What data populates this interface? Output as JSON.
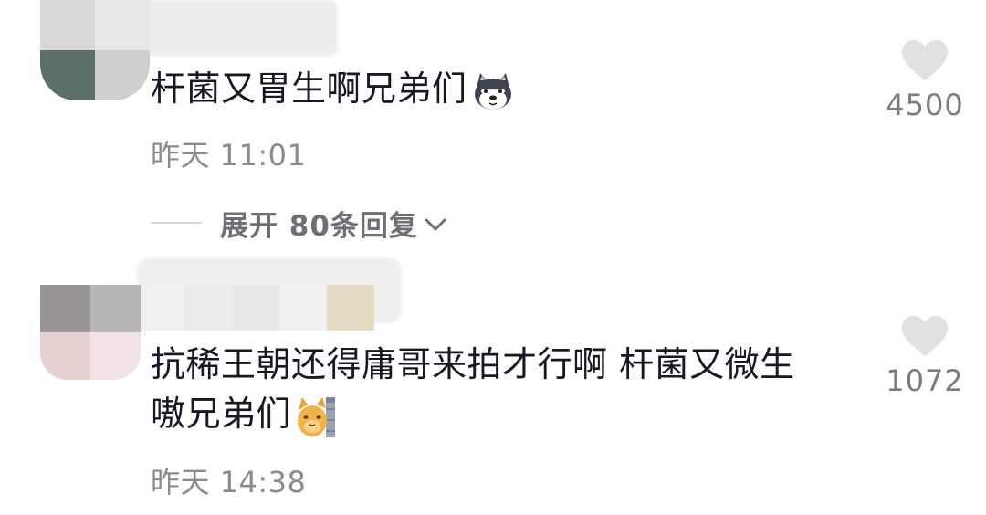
{
  "comments": [
    {
      "text": "杆菌又胃生啊兄弟们",
      "emoji": "husky-dog-emoji",
      "time": "昨天 11:01",
      "likes": "4500",
      "replies_label": "展开 80条回复"
    },
    {
      "text_line1": "抗稀王朝还得庸哥来拍才行啊 杆菌又微生",
      "text_line2": "嗷兄弟们",
      "emoji": "cat-peeking-emoji",
      "time": "昨天 14:38",
      "likes": "1072"
    }
  ],
  "icons": {
    "like": "heart-icon",
    "expand": "chevron-down-icon"
  },
  "colors": {
    "text": "#161823",
    "secondary": "#8a8b91",
    "heart": "#e1e1e3"
  }
}
